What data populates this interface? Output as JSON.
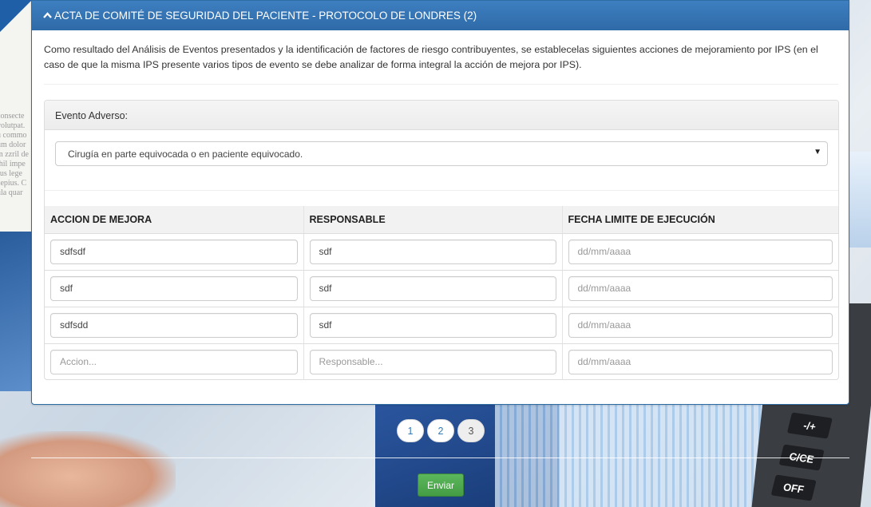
{
  "panel": {
    "title": "ACTA DE COMITÉ DE SEGURIDAD DEL PACIENTE - PROTOCOLO DE LONDRES (2)",
    "intro": "Como resultado del Análisis de Eventos presentados y la identificación de factores de riesgo contribuyentes, se establecelas siguientes acciones de mejoramiento por IPS (en el caso de que la misma IPS presente varios tipos de evento se debe analizar de forma integral la acción de mejora por IPS)."
  },
  "evento": {
    "label": "Evento Adverso:",
    "selected": "Cirugía en parte equivocada o en paciente equivocado."
  },
  "table": {
    "headers": [
      "ACCION DE MEJORA",
      "RESPONSABLE",
      "FECHA LIMITE DE EJECUCIÓN"
    ],
    "rows": [
      {
        "accion": "sdfsdf",
        "responsable": "sdf",
        "fecha_placeholder": "dd/mm/aaaa"
      },
      {
        "accion": "sdf",
        "responsable": "sdf",
        "fecha_placeholder": "dd/mm/aaaa"
      },
      {
        "accion": "sdfsdd",
        "responsable": "sdf",
        "fecha_placeholder": "dd/mm/aaaa"
      }
    ],
    "new_row": {
      "accion_placeholder": "Accion...",
      "responsable_placeholder": "Responsable...",
      "fecha_placeholder": "dd/mm/aaaa"
    }
  },
  "pagination": {
    "pages": [
      "1",
      "2",
      "3"
    ],
    "active": "3"
  },
  "submit_label": "Enviar",
  "icons": {
    "heading": "chevron-up-icon",
    "select": "caret-down-icon"
  },
  "colors": {
    "panel_heading": "#3d7fc0",
    "submit": "#5cb85c",
    "link": "#337ab7"
  }
}
